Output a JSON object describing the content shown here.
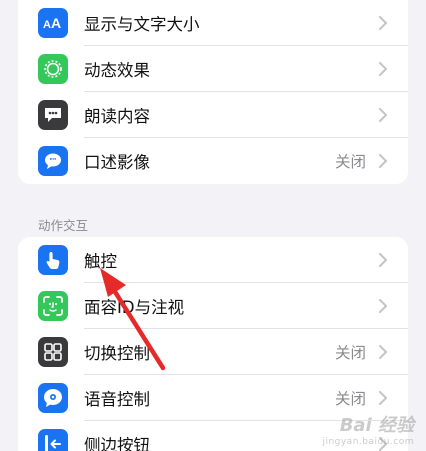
{
  "colors": {
    "background": "#f2f2f7",
    "accent_blue": "#1a73f0",
    "green": "#34c759",
    "dark_gray": "#3a3a3c",
    "annotation_red": "#e62a2a"
  },
  "group1": {
    "rows": [
      {
        "label": "显示与文字大小",
        "value": "",
        "icon": "text-size-icon"
      },
      {
        "label": "动态效果",
        "value": "",
        "icon": "motion-icon"
      },
      {
        "label": "朗读内容",
        "value": "",
        "icon": "spoken-content-icon"
      },
      {
        "label": "口述影像",
        "value": "关闭",
        "icon": "audio-description-icon"
      }
    ]
  },
  "section2": {
    "header": "动作交互",
    "rows": [
      {
        "label": "触控",
        "value": "",
        "icon": "touch-icon"
      },
      {
        "label": "面容ID与注视",
        "value": "",
        "icon": "face-id-icon"
      },
      {
        "label": "切换控制",
        "value": "关闭",
        "icon": "switch-control-icon"
      },
      {
        "label": "语音控制",
        "value": "关闭",
        "icon": "voice-control-icon"
      },
      {
        "label": "侧边按钮",
        "value": "",
        "icon": "side-button-icon"
      }
    ]
  },
  "watermark": {
    "main": "Bai 经验",
    "sub": "jingyan.baidu.com"
  }
}
